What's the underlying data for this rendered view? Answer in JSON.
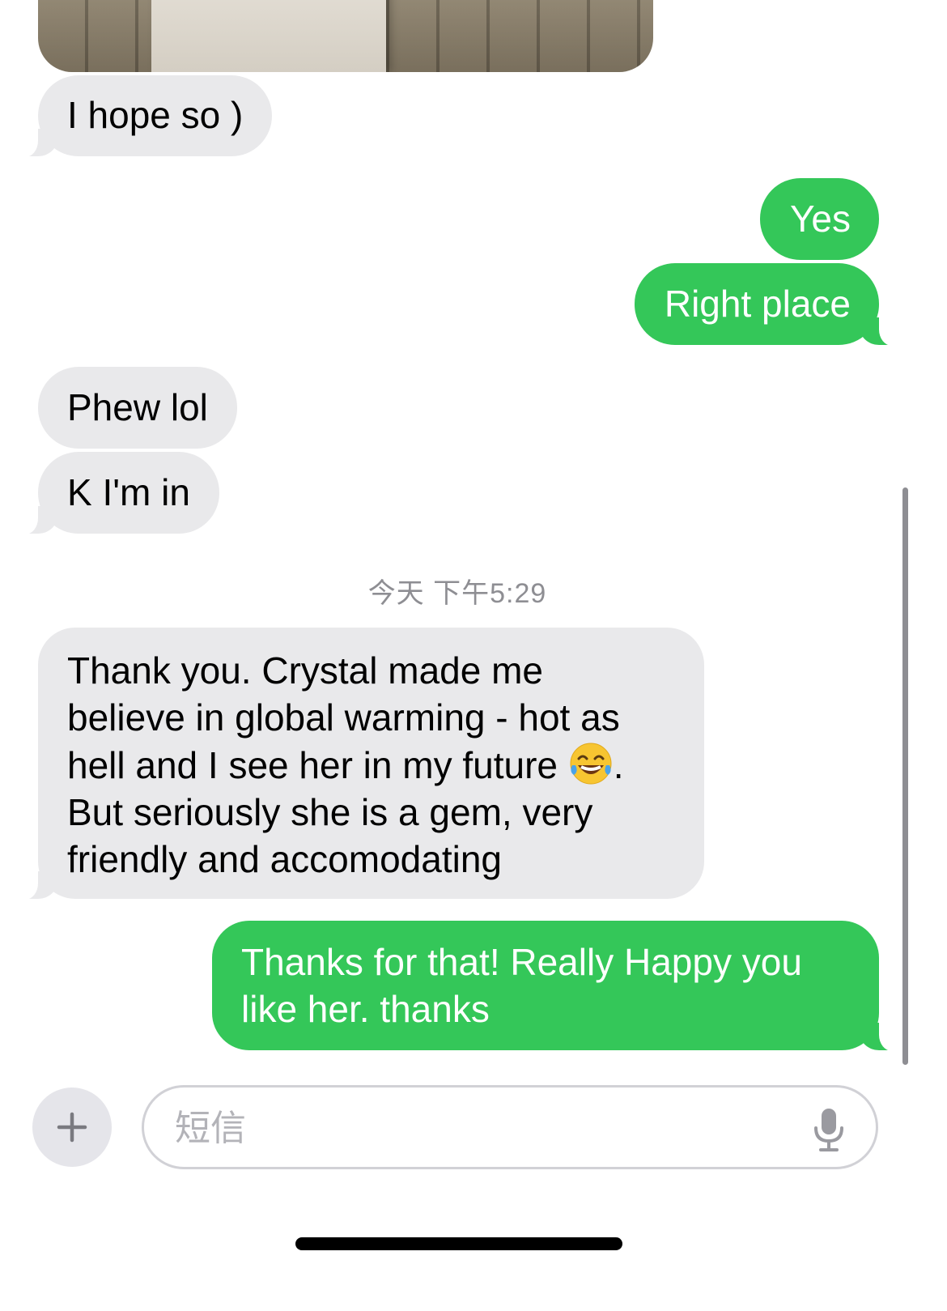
{
  "colors": {
    "incoming_bubble": "#e9e9eb",
    "outgoing_bubble": "#34c759",
    "timestamp_text": "#8e8e93"
  },
  "messages": [
    {
      "direction": "incoming",
      "type": "image",
      "content_icon": "photo-attachment"
    },
    {
      "direction": "incoming",
      "text": "I hope so )"
    },
    {
      "direction": "outgoing",
      "text": "Yes"
    },
    {
      "direction": "outgoing",
      "text": "Right place"
    },
    {
      "direction": "incoming",
      "text": "Phew lol"
    },
    {
      "direction": "incoming",
      "text": "K I'm in"
    },
    {
      "direction": "incoming",
      "lines": [
        "Thank you. Crystal made me",
        "believe in global warming - hot as",
        "hell and I see her in my future",
        "But seriously she is a gem, very",
        "friendly and accomodating"
      ],
      "line3_suffix": ".",
      "emoji_icon": "tears-of-joy-emoji"
    },
    {
      "direction": "outgoing",
      "lines": [
        "Thanks for that! Really Happy you",
        "like her. thanks"
      ]
    }
  ],
  "timestamp": "今天 下午5:29",
  "composer": {
    "add_icon": "plus-icon",
    "placeholder": "短信",
    "mic_icon": "microphone-icon"
  }
}
